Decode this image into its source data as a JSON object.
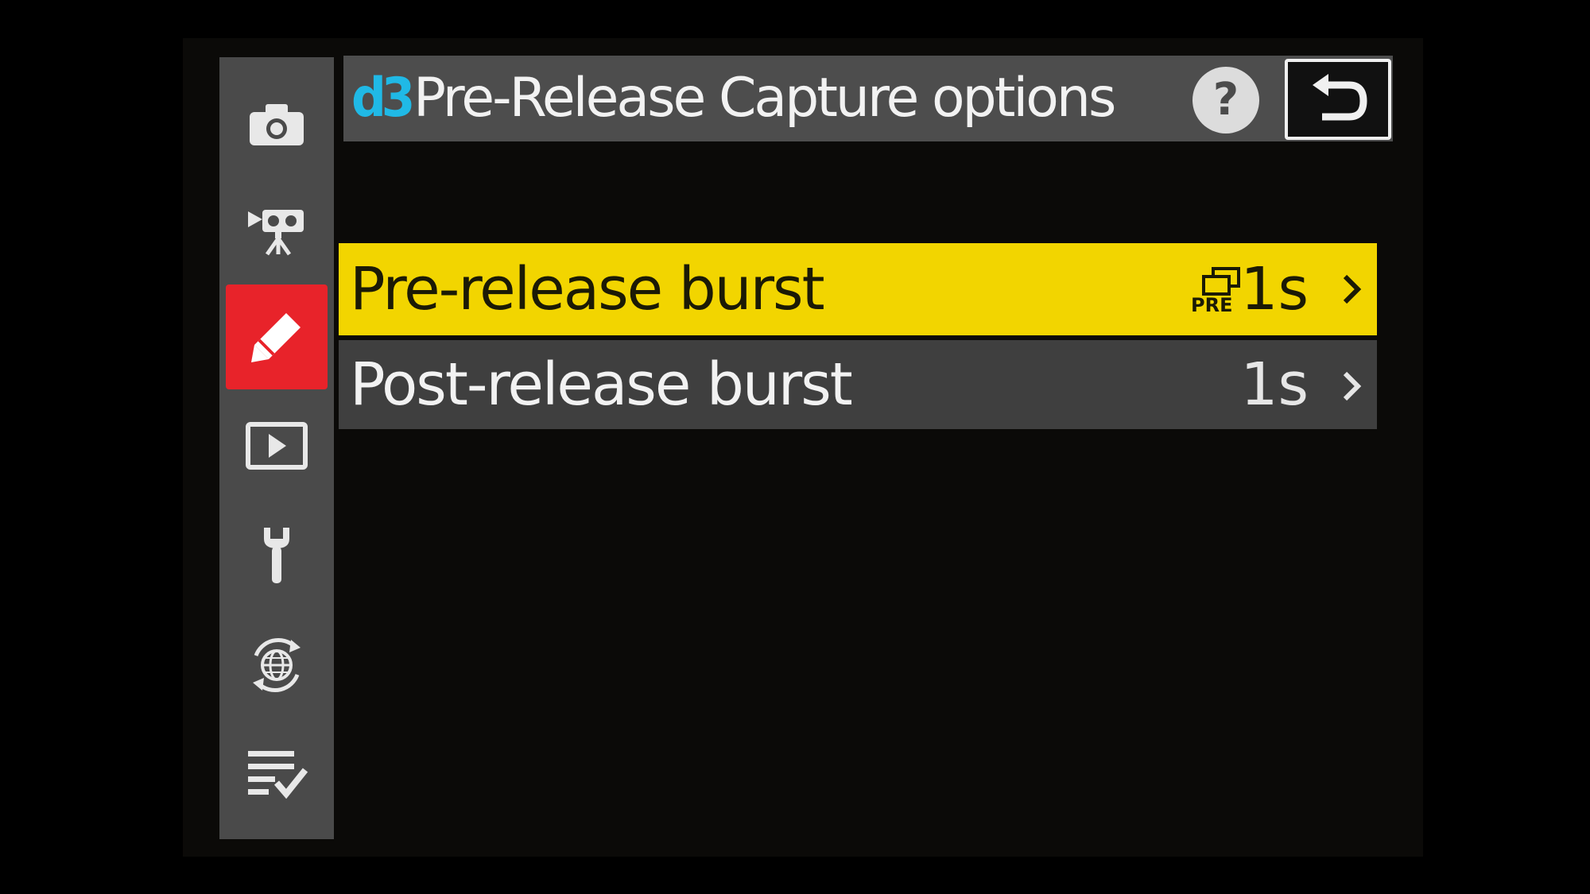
{
  "header": {
    "code": "d3",
    "title": "Pre-Release Capture options",
    "help_label": "?"
  },
  "sidebar": {
    "items": [
      {
        "name": "photo-shooting-menu",
        "icon": "camera-icon",
        "active": false
      },
      {
        "name": "video-recording-menu",
        "icon": "video-camera-icon",
        "active": false
      },
      {
        "name": "custom-settings-menu",
        "icon": "pencil-icon",
        "active": true
      },
      {
        "name": "playback-menu",
        "icon": "playback-icon",
        "active": false
      },
      {
        "name": "setup-menu",
        "icon": "wrench-icon",
        "active": false
      },
      {
        "name": "network-menu",
        "icon": "globe-icon",
        "active": false
      },
      {
        "name": "my-menu",
        "icon": "list-check-icon",
        "active": false
      }
    ]
  },
  "menu": {
    "items": [
      {
        "label": "Pre-release burst",
        "value": "1s",
        "icon": "pre-burst-icon",
        "icon_text": "PRE",
        "selected": true
      },
      {
        "label": "Post-release burst",
        "value": "1s",
        "selected": false
      }
    ]
  },
  "colors": {
    "accent_yellow": "#f2d500",
    "active_red": "#e8232a",
    "code_blue": "#20b9e6",
    "panel_gray": "#4a4a4a",
    "background": "#0b0a08"
  }
}
